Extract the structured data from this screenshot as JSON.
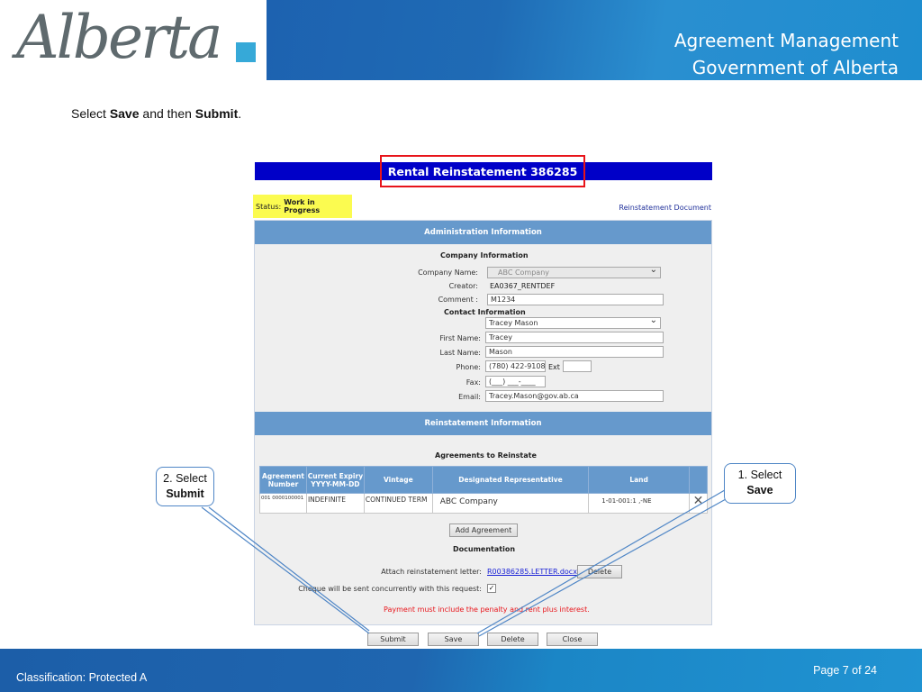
{
  "header": {
    "logo_text": "Alberta",
    "title_line1": "Agreement Management",
    "title_line2": "Government of Alberta"
  },
  "instruction": {
    "prefix": "Select ",
    "save": "Save",
    "middle": " and then ",
    "submit": "Submit",
    "suffix": "."
  },
  "form": {
    "title": "Rental Reinstatement 386285",
    "status_label": "Status:",
    "status_value": "Work in Progress",
    "reinstatement_document_link": "Reinstatement Document",
    "admin_section": "Administration Information",
    "company_info_title": "Company Information",
    "company_name_label": "Company Name:",
    "company_name_value": "ABC Company",
    "creator_label": "Creator:",
    "creator_value": "EA0367_RENTDEF",
    "comment_label": "Comment :",
    "comment_value": "M1234",
    "contact_info_title": "Contact Information",
    "contact_select_value": "Tracey Mason",
    "first_name_label": "First Name:",
    "first_name_value": "Tracey",
    "last_name_label": "Last Name:",
    "last_name_value": "Mason",
    "phone_label": "Phone:",
    "phone_value": "(780) 422-9108",
    "ext_label": "Ext",
    "ext_value": "",
    "fax_label": "Fax:",
    "fax_value": "(___) ___-____",
    "email_label": "Email:",
    "email_value": "Tracey.Mason@gov.ab.ca",
    "reinstatement_section": "Reinstatement Information",
    "agreements_title": "Agreements to Reinstate",
    "table": {
      "headers": [
        "Agreement Number",
        "Current Expiry YYYY-MM-DD",
        "Vintage",
        "Designated Representative",
        "Land",
        ""
      ],
      "rows": [
        {
          "agreement_number": "001 0000100001",
          "current_expiry": "INDEFINITE",
          "vintage": "CONTINUED TERM",
          "designated_representative": "ABC Company",
          "land": "1-01-001:1 ,-NE"
        }
      ]
    },
    "add_agreement_button": "Add Agreement",
    "documentation_title": "Documentation",
    "attach_letter_label": "Attach reinstatement letter:",
    "attach_letter_file": "R00386285.LETTER.docx",
    "attach_delete_button": "Delete",
    "cheque_label": "Cheque will be sent concurrently with this request:",
    "cheque_checked": true,
    "payment_warning": "Payment must include the penalty and rent plus interest.",
    "buttons": {
      "submit": "Submit",
      "save": "Save",
      "delete": "Delete",
      "close": "Close"
    }
  },
  "callouts": {
    "submit_step": "2. Select",
    "submit_word": "Submit",
    "save_step": "1. Select",
    "save_word": "Save"
  },
  "footer": {
    "classification": "Classification: Protected A",
    "page": "Page 7 of 24"
  },
  "colors": {
    "title_bar": "#0000c8",
    "highlight_box": "#e8141a",
    "section_header": "#6699cc",
    "status_highlight": "#fbfb50",
    "callout_border": "#4f86c6"
  }
}
